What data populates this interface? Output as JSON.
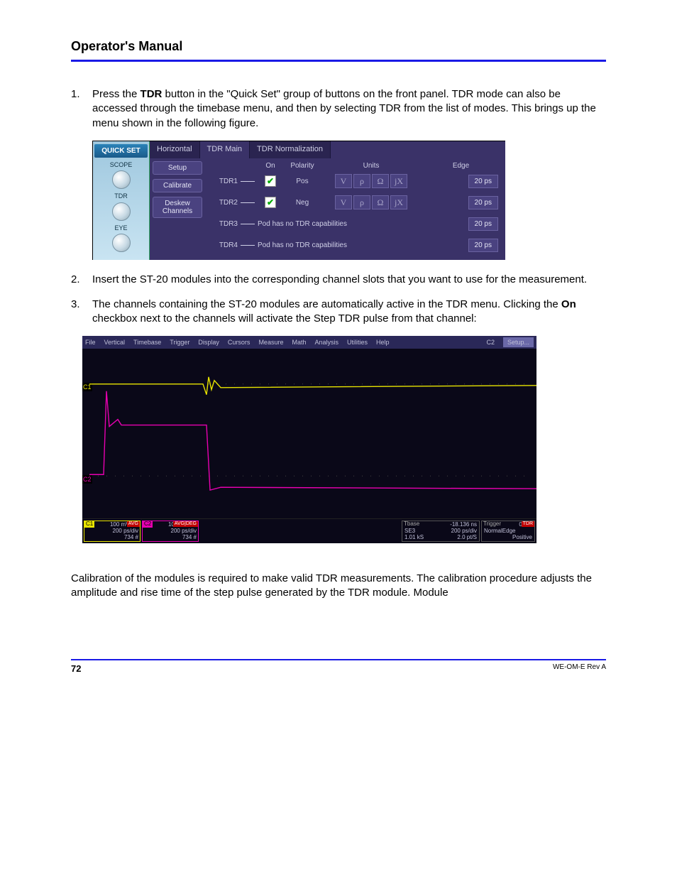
{
  "header": {
    "title": "Operator's Manual"
  },
  "steps": [
    {
      "num": "1.",
      "pre": "Press the ",
      "bold": "TDR",
      "post": " button in the \"Quick Set\" group of buttons on the front panel. TDR mode can also be accessed through the timebase menu, and then by selecting TDR from the list of modes. This brings up the menu shown in the following figure."
    },
    {
      "num": "2.",
      "text": "Insert the ST-20 modules into the corresponding channel slots that you want to use for the measurement."
    },
    {
      "num": "3.",
      "pre": "The channels containing the ST-20 modules are automatically active in the TDR menu. Clicking the ",
      "bold": "On",
      "post": " checkbox next to the channels will activate the Step TDR pulse from that channel:"
    }
  ],
  "quickset": {
    "title": "QUICK SET",
    "items": [
      "SCOPE",
      "TDR",
      "EYE"
    ]
  },
  "tdrMenu": {
    "tabs": [
      "Horizontal",
      "TDR Main",
      "TDR Normalization"
    ],
    "leftButtons": [
      "Setup",
      "Calibrate",
      "Deskew Channels"
    ],
    "headers": {
      "on": "On",
      "polarity": "Polarity",
      "units": "Units",
      "edge": "Edge"
    },
    "units": [
      "V",
      "ρ",
      "Ω",
      "jX"
    ],
    "rows": [
      {
        "ch": "TDR1",
        "on": true,
        "polarity": "Pos",
        "hasPod": true,
        "edge": "20 ps"
      },
      {
        "ch": "TDR2",
        "on": true,
        "polarity": "Neg",
        "hasPod": true,
        "edge": "20 ps"
      },
      {
        "ch": "TDR3",
        "hasPod": false,
        "noPodMsg": "Pod has no TDR capabilities",
        "edge": "20 ps"
      },
      {
        "ch": "TDR4",
        "hasPod": false,
        "noPodMsg": "Pod has no TDR capabilities",
        "edge": "20 ps"
      }
    ]
  },
  "scope": {
    "menu": [
      "File",
      "Vertical",
      "Timebase",
      "Trigger",
      "Display",
      "Cursors",
      "Measure",
      "Math",
      "Analysis",
      "Utilities",
      "Help"
    ],
    "rightLabel": "C2",
    "setup": "Setup...",
    "channels": {
      "c1": {
        "tag": "C1",
        "avg": "AVG",
        "l1": "100 mV/div",
        "l2": "200 ps/div",
        "l3": "734 #"
      },
      "c2": {
        "tag": "C2",
        "avg": "AVG|DEG",
        "l1": "100 mV/div",
        "l2": "200 ps/div",
        "l3": "734 #"
      }
    },
    "tbase": {
      "label": "Tbase",
      "l1": "-18.136 ns",
      "l2": "200 ps/div",
      "l3": "2.0 pt/S",
      "left1": "SE3",
      "left2": "1.01 kS"
    },
    "trigger": {
      "label": "Trigger",
      "tag": "TDR",
      "l1": "0 mV",
      "l2": "Normal",
      "l3": "Edge",
      "l4": "Positive"
    }
  },
  "calibrate_para": "Calibration of the modules is required to make valid TDR measurements. The calibration procedure adjusts the amplitude and rise time of the step pulse generated by the TDR module. Module",
  "footer": {
    "page": "72",
    "rev": "WE-OM-E Rev A"
  }
}
